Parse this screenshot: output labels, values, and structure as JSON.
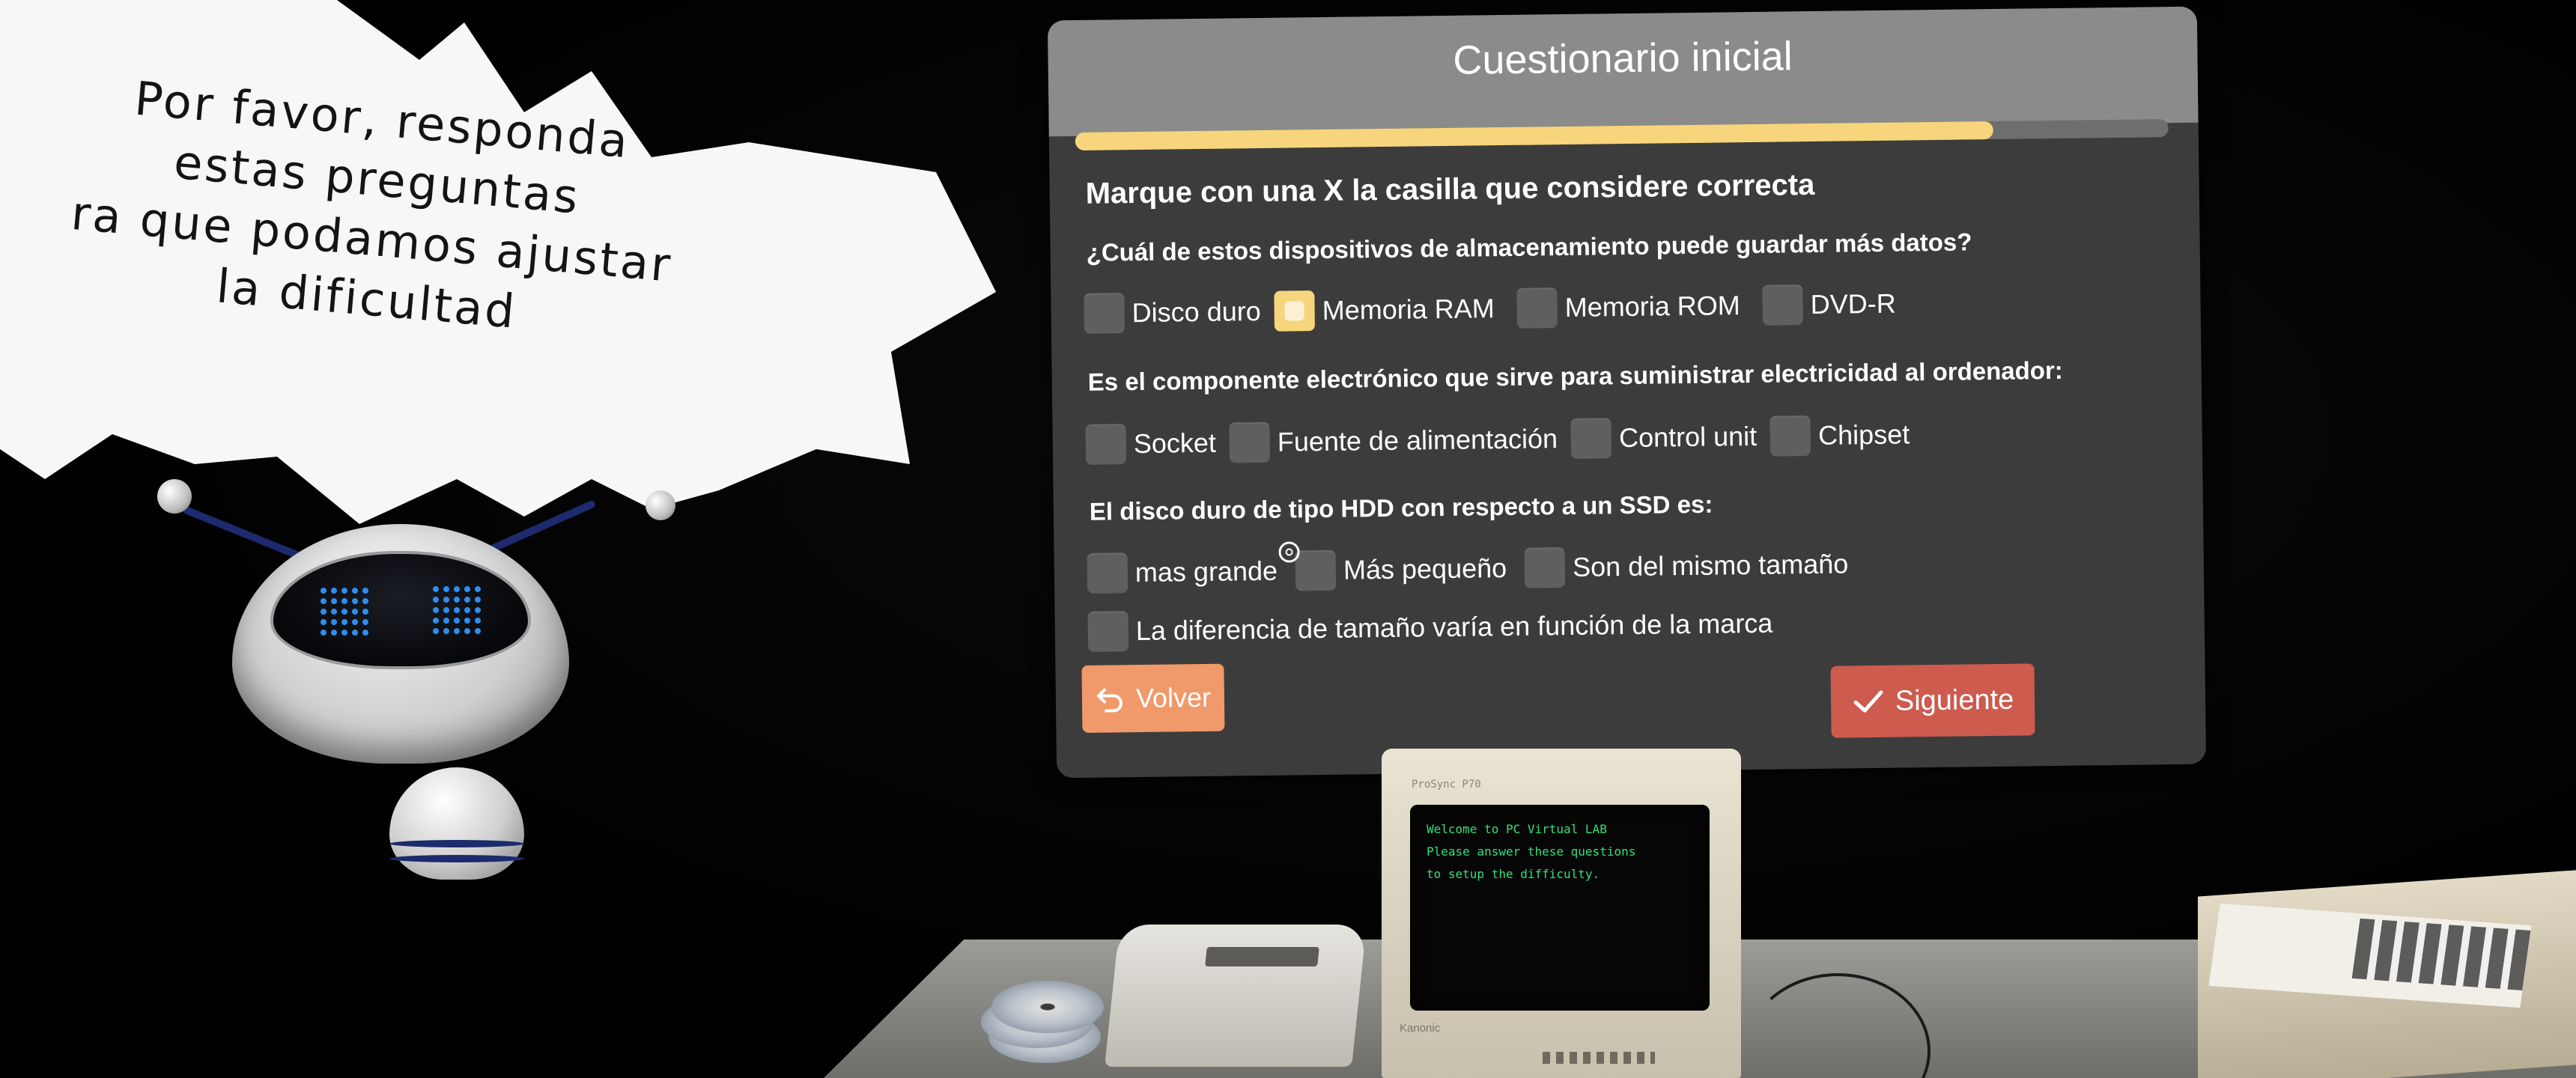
{
  "speech_bubble": {
    "lines": [
      "Por favor, responda",
      "estas preguntas",
      "ra que podamos ajustar",
      "la dificultad"
    ]
  },
  "quiz": {
    "title": "Cuestionario inicial",
    "progress_fraction": 0.84,
    "instructions": "Marque con una X la casilla que considere correcta",
    "questions": [
      {
        "text": "¿Cuál de estos dispositivos de almacenamiento puede guardar más datos?",
        "options": [
          "Disco duro",
          "Memoria RAM",
          "Memoria ROM",
          "DVD-R"
        ],
        "highlighted_option": "Memoria RAM"
      },
      {
        "text": "Es el componente electrónico que sirve para suministrar electricidad al ordenador:",
        "options": [
          "Socket",
          "Fuente de alimentación",
          "Control unit",
          "Chipset"
        ]
      },
      {
        "text": "El disco duro de tipo HDD con respecto a un SSD es:",
        "options": [
          "mas grande",
          "Más pequeño",
          "Son del mismo tamaño",
          "La diferencia de tamaño varía en función de la marca"
        ]
      }
    ],
    "back_button": {
      "label": "Volver",
      "icon": "undo-arrow-icon"
    },
    "next_button": {
      "label": "Siguiente",
      "icon": "checkmark-icon"
    }
  },
  "monitor": {
    "brand": "ProSync P70",
    "maker": "Kanonic",
    "terminal_lines": [
      "Welcome to PC Virtual LAB",
      "",
      "Please answer these questions",
      "to setup the difficulty."
    ]
  },
  "colors": {
    "accent_yellow": "#f7d57c",
    "back_button": "#f0996a",
    "next_button": "#cd5b4e",
    "panel_bg": "#404040",
    "header_bg": "#8b8b8b",
    "terminal_green": "#32e07a"
  }
}
